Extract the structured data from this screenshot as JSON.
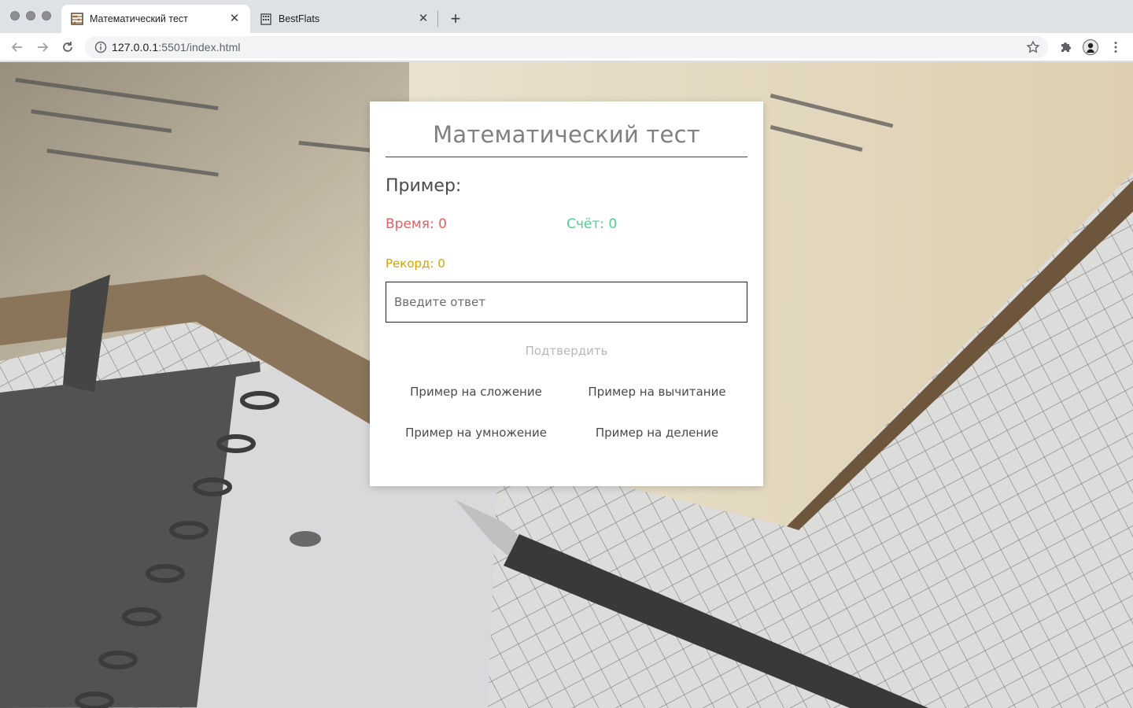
{
  "browser": {
    "tabs": [
      {
        "title": "Математический тест",
        "active": true,
        "favicon": "abacus-icon"
      },
      {
        "title": "BestFlats",
        "active": false,
        "favicon": "building-icon"
      }
    ],
    "url_host": "127.0.0.1",
    "url_rest": ":5501/index.html"
  },
  "quiz": {
    "title": "Математический тест",
    "example_label": "Пример:",
    "time_label": "Время: 0",
    "score_label": "Счёт: 0",
    "record_label": "Рекорд: 0",
    "answer_placeholder": "Введите ответ",
    "answer_value": "",
    "confirm_label": "Подтвердить",
    "operations": {
      "addition": "Пример на сложение",
      "subtraction": "Пример на вычитание",
      "multiplication": "Пример на умножение",
      "division": "Пример на деление"
    }
  },
  "colors": {
    "time": "#e85d5d",
    "score": "#4bd48b",
    "record": "#d4a500"
  }
}
